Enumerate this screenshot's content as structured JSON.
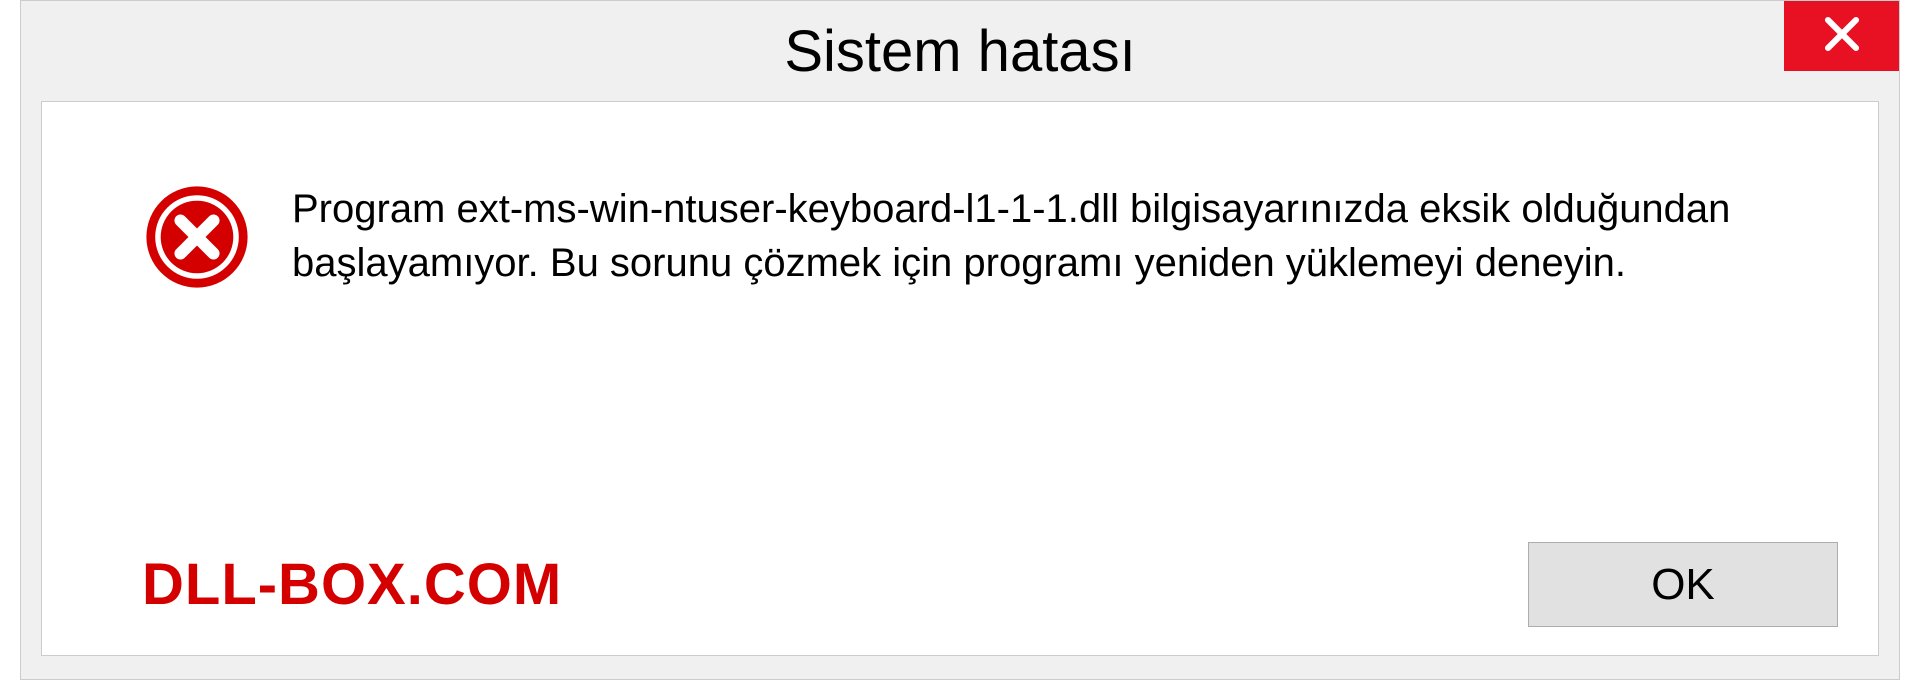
{
  "dialog": {
    "title": "Sistem hatası",
    "message": "Program ext-ms-win-ntuser-keyboard-l1-1-1.dll bilgisayarınızda eksik olduğundan başlayamıyor. Bu sorunu çözmek için programı yeniden yüklemeyi deneyin.",
    "ok_label": "OK",
    "watermark": "DLL-BOX.COM"
  },
  "colors": {
    "close_bg": "#e81123",
    "error_icon": "#d40000",
    "watermark": "#d40000"
  }
}
